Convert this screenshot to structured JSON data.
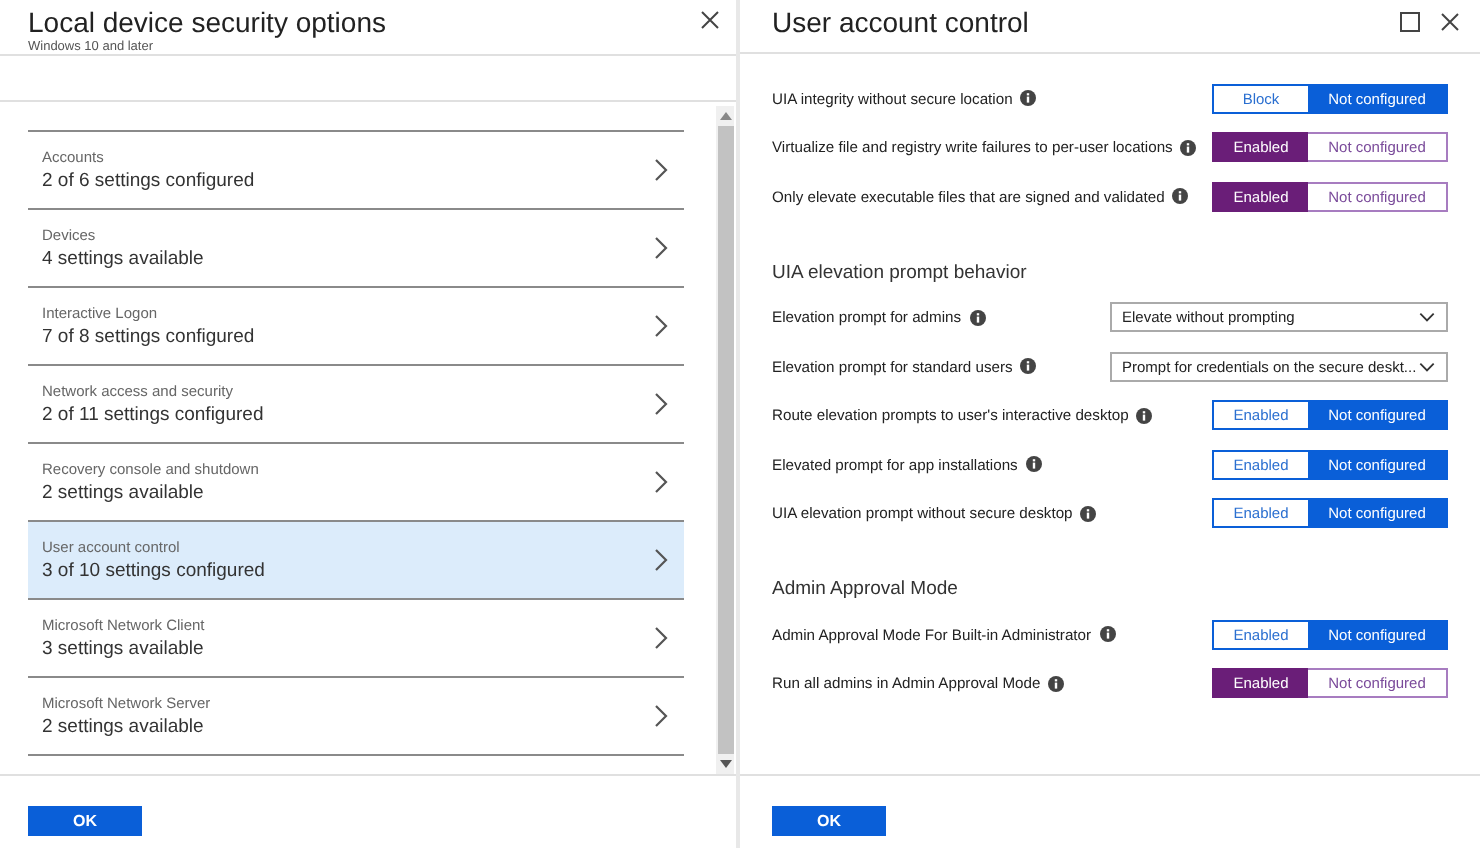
{
  "left_panel": {
    "title": "Local device security options",
    "subtitle": "Windows 10 and later",
    "items": [
      {
        "label": "Accounts",
        "status": "2 of 6 settings configured",
        "selected": false
      },
      {
        "label": "Devices",
        "status": "4 settings available",
        "selected": false
      },
      {
        "label": "Interactive Logon",
        "status": "7 of 8 settings configured",
        "selected": false
      },
      {
        "label": "Network access and security",
        "status": "2 of 11 settings configured",
        "selected": false
      },
      {
        "label": "Recovery console and shutdown",
        "status": "2 settings available",
        "selected": false
      },
      {
        "label": "User account control",
        "status": "3 of 10 settings configured",
        "selected": true
      },
      {
        "label": "Microsoft Network Client",
        "status": "3 settings available",
        "selected": false
      },
      {
        "label": "Microsoft Network Server",
        "status": "2 settings available",
        "selected": false
      }
    ],
    "ok_button": "OK"
  },
  "right_panel": {
    "title": "User account control",
    "settings": [
      {
        "kind": "toggle",
        "label": "UIA integrity without secure location",
        "options": [
          {
            "label": "Block",
            "selected": false
          },
          {
            "label": "Not configured",
            "selected": true
          }
        ]
      },
      {
        "kind": "toggle",
        "label": "Virtualize file and registry write failures to per-user locations",
        "options": [
          {
            "label": "Enabled",
            "selected": true
          },
          {
            "label": "Not configured",
            "selected": false
          }
        ]
      },
      {
        "kind": "toggle",
        "label": "Only elevate executable files that are signed and validated",
        "options": [
          {
            "label": "Enabled",
            "selected": true
          },
          {
            "label": "Not configured",
            "selected": false
          }
        ]
      },
      {
        "kind": "heading",
        "label": "UIA elevation prompt behavior"
      },
      {
        "kind": "dropdown",
        "label": "Elevation prompt for admins",
        "value": "Elevate without prompting"
      },
      {
        "kind": "dropdown",
        "label": "Elevation prompt for standard users",
        "value": "Prompt for credentials on the secure deskt..."
      },
      {
        "kind": "toggle",
        "label": "Route elevation prompts to user's interactive desktop",
        "options": [
          {
            "label": "Enabled",
            "selected": false
          },
          {
            "label": "Not configured",
            "selected": true
          }
        ]
      },
      {
        "kind": "toggle",
        "label": "Elevated prompt for app installations",
        "options": [
          {
            "label": "Enabled",
            "selected": false
          },
          {
            "label": "Not configured",
            "selected": true
          }
        ]
      },
      {
        "kind": "toggle",
        "label": "UIA elevation prompt without secure desktop",
        "options": [
          {
            "label": "Enabled",
            "selected": false
          },
          {
            "label": "Not configured",
            "selected": true
          }
        ]
      },
      {
        "kind": "heading",
        "label": "Admin Approval Mode"
      },
      {
        "kind": "toggle",
        "label": "Admin Approval Mode For Built-in Administrator",
        "options": [
          {
            "label": "Enabled",
            "selected": false
          },
          {
            "label": "Not configured",
            "selected": true
          }
        ]
      },
      {
        "kind": "toggle",
        "label": "Run all admins in Admin Approval Mode",
        "options": [
          {
            "label": "Enabled",
            "selected": true
          },
          {
            "label": "Not configured",
            "selected": false
          }
        ]
      }
    ],
    "ok_button": "OK"
  }
}
